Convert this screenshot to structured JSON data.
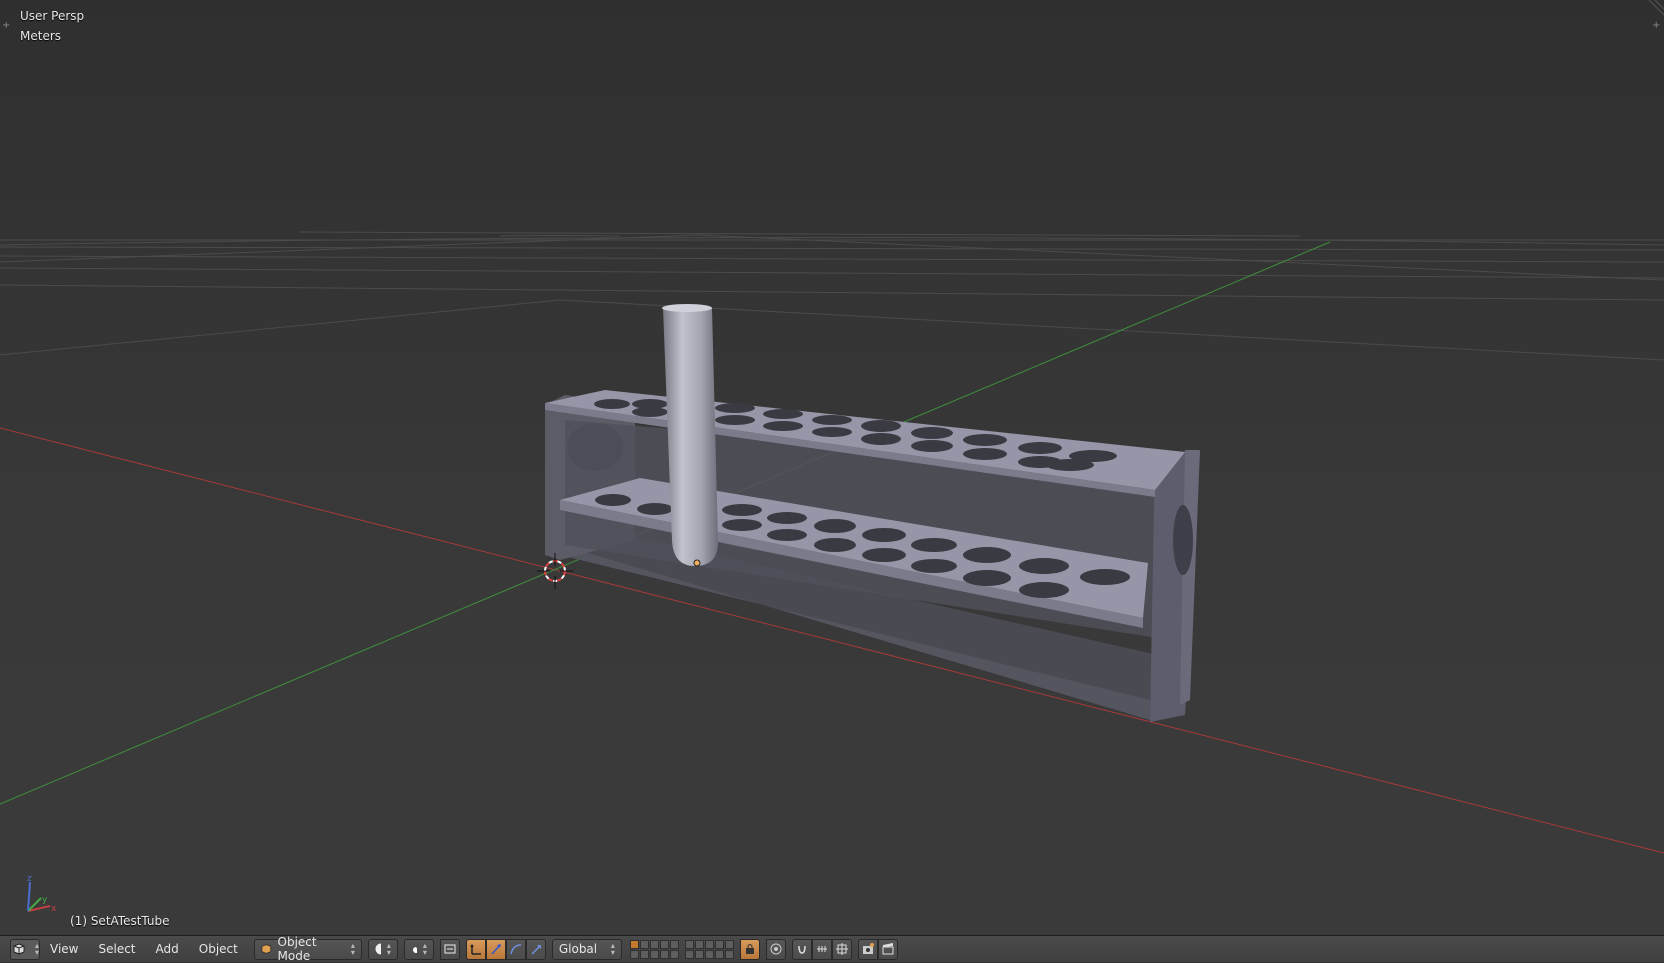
{
  "viewport": {
    "view_name": "User Persp",
    "units": "Meters",
    "object_name": "(1) SetATestTube",
    "axis_labels": {
      "x": "x",
      "y": "y",
      "z": "z"
    },
    "colors": {
      "background": "#333333",
      "grid": "#4a4a4a",
      "x_axis": "#b33a3a",
      "y_axis": "#3f9b3f",
      "rack": "#8d8da0",
      "tube": "#b8b8c4"
    }
  },
  "header": {
    "editor_type_icon": "3d-view-icon",
    "menus": [
      "View",
      "Select",
      "Add",
      "Object"
    ],
    "mode": "Object Mode",
    "viewport_shading_icon": "solid-sphere-icon",
    "pivot_icon": "pivot-point-icon",
    "manipulator_icons": [
      "manipulator-toggle-icon",
      "translate-icon",
      "rotate-icon",
      "scale-icon"
    ],
    "transform_orientation": "Global",
    "proportional_icon": "proportional-edit-icon",
    "snap_icons": [
      "snap-toggle-icon",
      "snap-element-icon",
      "snap-target-icon"
    ],
    "render_icons": [
      "render-still-icon",
      "render-animation-icon"
    ]
  }
}
